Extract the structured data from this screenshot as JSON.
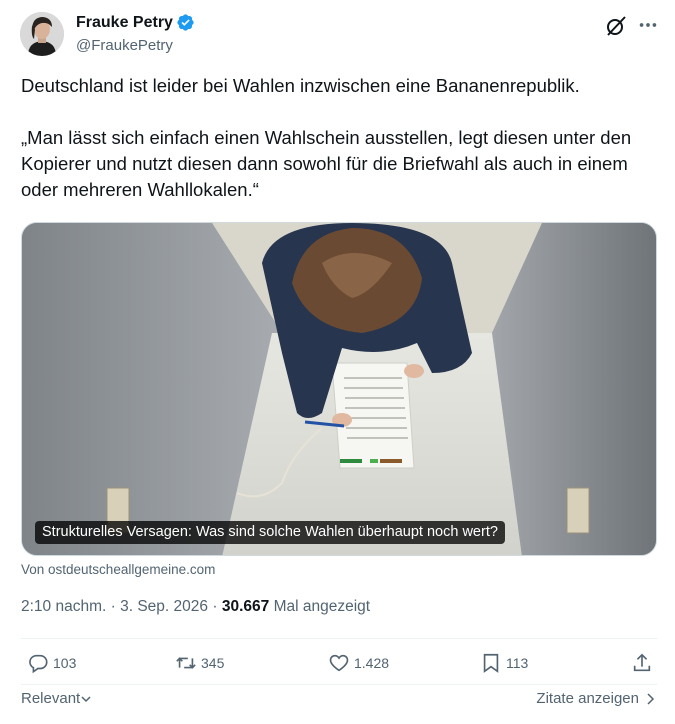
{
  "author": {
    "display_name": "Frauke Petry",
    "handle": "@FraukePetry",
    "verified_color": "#1d9bf0"
  },
  "header_icons": [
    "grok-icon",
    "more-icon"
  ],
  "tweet": {
    "paragraph_1": "Deutschland ist leider bei Wahlen inzwischen eine Bananenrepublik.",
    "paragraph_2": "„Man lässt sich einfach einen Wahlschein ausstellen, legt diesen unter den Kopierer und nutzt diesen dann sowohl für die Briefwahl als auch in einem oder mehreren Wahllokalen.“"
  },
  "card": {
    "caption": "Strukturelles Versagen: Was sind solche Wahlen überhaupt noch wert?",
    "source": "Von ostdeutscheallgemeine.com"
  },
  "meta": {
    "time": "2:10 nachm.",
    "separator": "·",
    "date": "3. Sep. 2026",
    "views": "30.667",
    "views_label": "Mal angezeigt"
  },
  "actions": {
    "replies": "103",
    "reposts": "345",
    "likes": "1.428",
    "bookmarks": "113"
  },
  "footer": {
    "sort_label": "Relevant",
    "quotes_label": "Zitate anzeigen"
  }
}
